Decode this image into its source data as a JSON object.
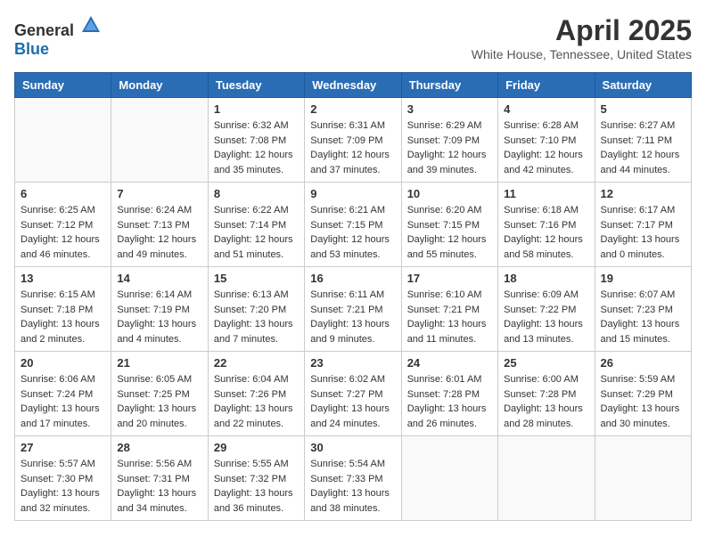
{
  "header": {
    "logo_general": "General",
    "logo_blue": "Blue",
    "month": "April 2025",
    "location": "White House, Tennessee, United States"
  },
  "weekdays": [
    "Sunday",
    "Monday",
    "Tuesday",
    "Wednesday",
    "Thursday",
    "Friday",
    "Saturday"
  ],
  "weeks": [
    [
      {
        "day": "",
        "info": ""
      },
      {
        "day": "",
        "info": ""
      },
      {
        "day": "1",
        "info": "Sunrise: 6:32 AM\nSunset: 7:08 PM\nDaylight: 12 hours and 35 minutes."
      },
      {
        "day": "2",
        "info": "Sunrise: 6:31 AM\nSunset: 7:09 PM\nDaylight: 12 hours and 37 minutes."
      },
      {
        "day": "3",
        "info": "Sunrise: 6:29 AM\nSunset: 7:09 PM\nDaylight: 12 hours and 39 minutes."
      },
      {
        "day": "4",
        "info": "Sunrise: 6:28 AM\nSunset: 7:10 PM\nDaylight: 12 hours and 42 minutes."
      },
      {
        "day": "5",
        "info": "Sunrise: 6:27 AM\nSunset: 7:11 PM\nDaylight: 12 hours and 44 minutes."
      }
    ],
    [
      {
        "day": "6",
        "info": "Sunrise: 6:25 AM\nSunset: 7:12 PM\nDaylight: 12 hours and 46 minutes."
      },
      {
        "day": "7",
        "info": "Sunrise: 6:24 AM\nSunset: 7:13 PM\nDaylight: 12 hours and 49 minutes."
      },
      {
        "day": "8",
        "info": "Sunrise: 6:22 AM\nSunset: 7:14 PM\nDaylight: 12 hours and 51 minutes."
      },
      {
        "day": "9",
        "info": "Sunrise: 6:21 AM\nSunset: 7:15 PM\nDaylight: 12 hours and 53 minutes."
      },
      {
        "day": "10",
        "info": "Sunrise: 6:20 AM\nSunset: 7:15 PM\nDaylight: 12 hours and 55 minutes."
      },
      {
        "day": "11",
        "info": "Sunrise: 6:18 AM\nSunset: 7:16 PM\nDaylight: 12 hours and 58 minutes."
      },
      {
        "day": "12",
        "info": "Sunrise: 6:17 AM\nSunset: 7:17 PM\nDaylight: 13 hours and 0 minutes."
      }
    ],
    [
      {
        "day": "13",
        "info": "Sunrise: 6:15 AM\nSunset: 7:18 PM\nDaylight: 13 hours and 2 minutes."
      },
      {
        "day": "14",
        "info": "Sunrise: 6:14 AM\nSunset: 7:19 PM\nDaylight: 13 hours and 4 minutes."
      },
      {
        "day": "15",
        "info": "Sunrise: 6:13 AM\nSunset: 7:20 PM\nDaylight: 13 hours and 7 minutes."
      },
      {
        "day": "16",
        "info": "Sunrise: 6:11 AM\nSunset: 7:21 PM\nDaylight: 13 hours and 9 minutes."
      },
      {
        "day": "17",
        "info": "Sunrise: 6:10 AM\nSunset: 7:21 PM\nDaylight: 13 hours and 11 minutes."
      },
      {
        "day": "18",
        "info": "Sunrise: 6:09 AM\nSunset: 7:22 PM\nDaylight: 13 hours and 13 minutes."
      },
      {
        "day": "19",
        "info": "Sunrise: 6:07 AM\nSunset: 7:23 PM\nDaylight: 13 hours and 15 minutes."
      }
    ],
    [
      {
        "day": "20",
        "info": "Sunrise: 6:06 AM\nSunset: 7:24 PM\nDaylight: 13 hours and 17 minutes."
      },
      {
        "day": "21",
        "info": "Sunrise: 6:05 AM\nSunset: 7:25 PM\nDaylight: 13 hours and 20 minutes."
      },
      {
        "day": "22",
        "info": "Sunrise: 6:04 AM\nSunset: 7:26 PM\nDaylight: 13 hours and 22 minutes."
      },
      {
        "day": "23",
        "info": "Sunrise: 6:02 AM\nSunset: 7:27 PM\nDaylight: 13 hours and 24 minutes."
      },
      {
        "day": "24",
        "info": "Sunrise: 6:01 AM\nSunset: 7:28 PM\nDaylight: 13 hours and 26 minutes."
      },
      {
        "day": "25",
        "info": "Sunrise: 6:00 AM\nSunset: 7:28 PM\nDaylight: 13 hours and 28 minutes."
      },
      {
        "day": "26",
        "info": "Sunrise: 5:59 AM\nSunset: 7:29 PM\nDaylight: 13 hours and 30 minutes."
      }
    ],
    [
      {
        "day": "27",
        "info": "Sunrise: 5:57 AM\nSunset: 7:30 PM\nDaylight: 13 hours and 32 minutes."
      },
      {
        "day": "28",
        "info": "Sunrise: 5:56 AM\nSunset: 7:31 PM\nDaylight: 13 hours and 34 minutes."
      },
      {
        "day": "29",
        "info": "Sunrise: 5:55 AM\nSunset: 7:32 PM\nDaylight: 13 hours and 36 minutes."
      },
      {
        "day": "30",
        "info": "Sunrise: 5:54 AM\nSunset: 7:33 PM\nDaylight: 13 hours and 38 minutes."
      },
      {
        "day": "",
        "info": ""
      },
      {
        "day": "",
        "info": ""
      },
      {
        "day": "",
        "info": ""
      }
    ]
  ]
}
